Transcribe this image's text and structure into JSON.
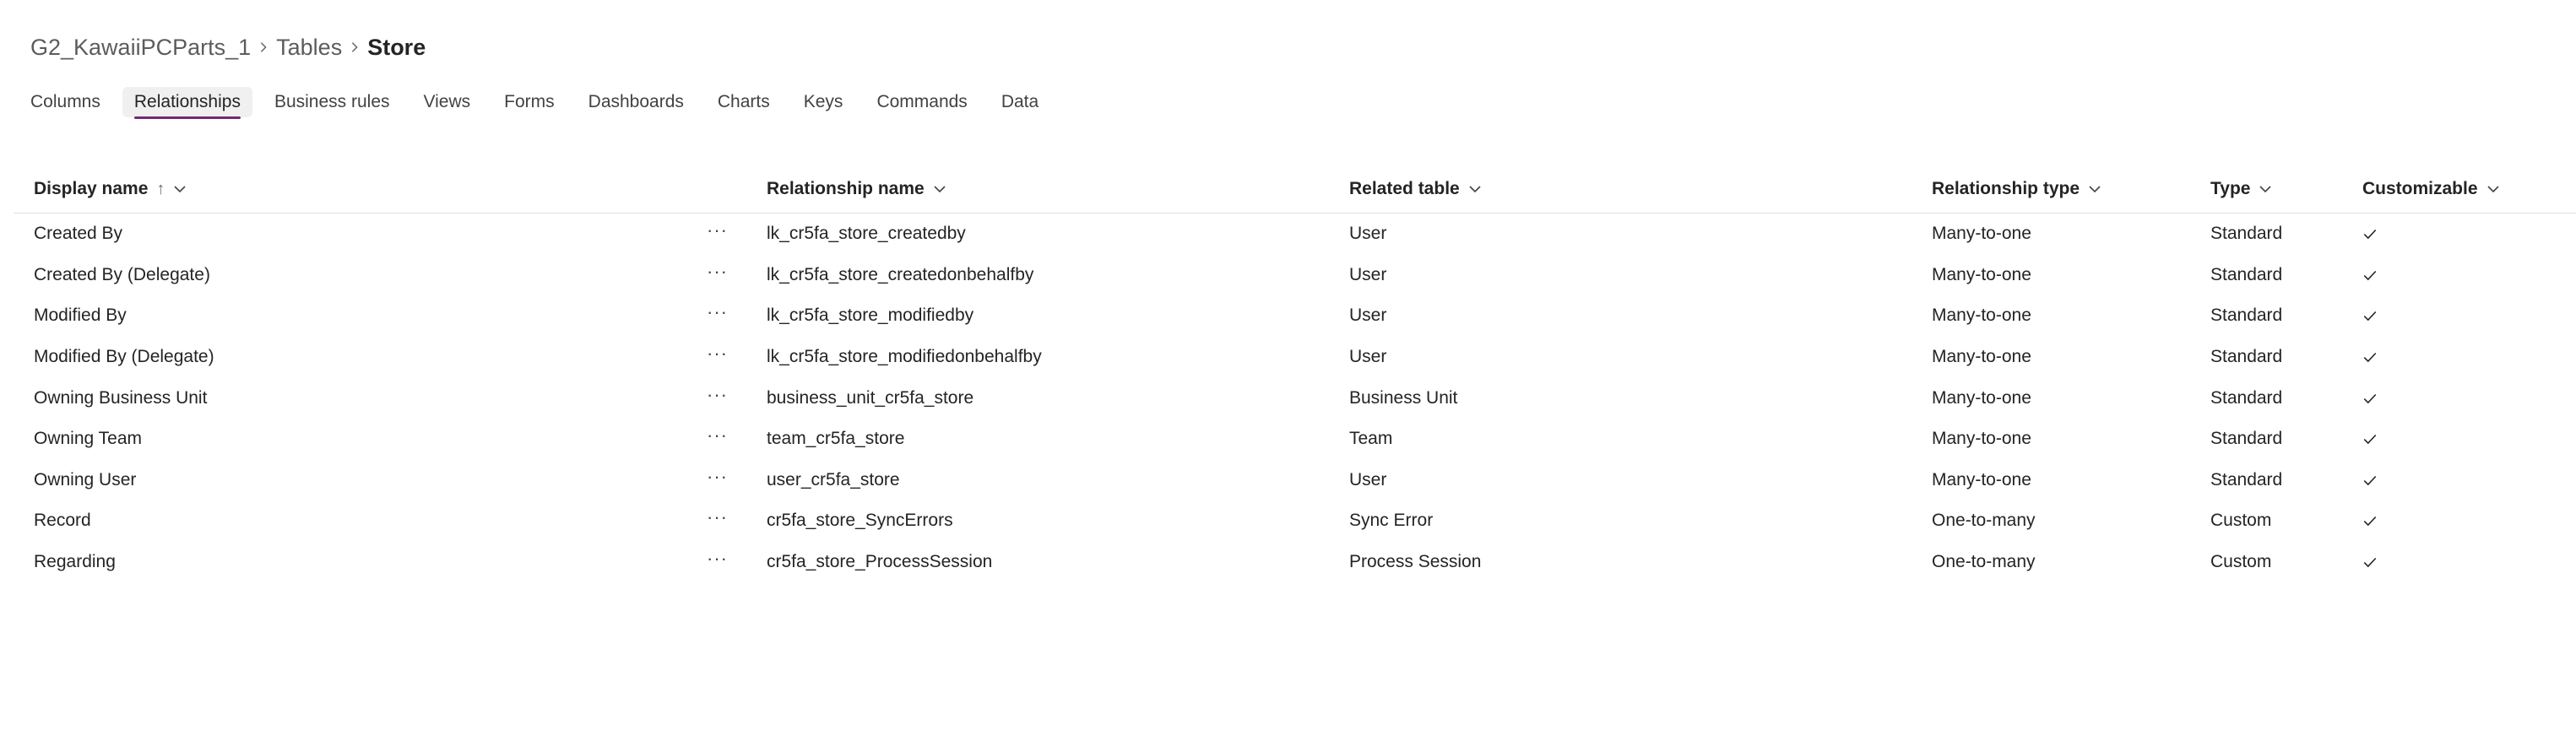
{
  "breadcrumb": {
    "items": [
      "G2_KawaiiPCParts_1",
      "Tables",
      "Store"
    ]
  },
  "tabs": [
    {
      "label": "Columns",
      "active": false
    },
    {
      "label": "Relationships",
      "active": true
    },
    {
      "label": "Business rules",
      "active": false
    },
    {
      "label": "Views",
      "active": false
    },
    {
      "label": "Forms",
      "active": false
    },
    {
      "label": "Dashboards",
      "active": false
    },
    {
      "label": "Charts",
      "active": false
    },
    {
      "label": "Keys",
      "active": false
    },
    {
      "label": "Commands",
      "active": false
    },
    {
      "label": "Data",
      "active": false
    }
  ],
  "table": {
    "headers": {
      "display_name": "Display name",
      "relationship_name": "Relationship name",
      "related_table": "Related table",
      "relationship_type": "Relationship type",
      "type": "Type",
      "customizable": "Customizable"
    },
    "sort_indicator": "↑",
    "more_label": "···",
    "rows": [
      {
        "display_name": "Created By",
        "relationship_name": "lk_cr5fa_store_createdby",
        "related_table": "User",
        "relationship_type": "Many-to-one",
        "type": "Standard",
        "customizable": true
      },
      {
        "display_name": "Created By (Delegate)",
        "relationship_name": "lk_cr5fa_store_createdonbehalfby",
        "related_table": "User",
        "relationship_type": "Many-to-one",
        "type": "Standard",
        "customizable": true
      },
      {
        "display_name": "Modified By",
        "relationship_name": "lk_cr5fa_store_modifiedby",
        "related_table": "User",
        "relationship_type": "Many-to-one",
        "type": "Standard",
        "customizable": true
      },
      {
        "display_name": "Modified By (Delegate)",
        "relationship_name": "lk_cr5fa_store_modifiedonbehalfby",
        "related_table": "User",
        "relationship_type": "Many-to-one",
        "type": "Standard",
        "customizable": true
      },
      {
        "display_name": "Owning Business Unit",
        "relationship_name": "business_unit_cr5fa_store",
        "related_table": "Business Unit",
        "relationship_type": "Many-to-one",
        "type": "Standard",
        "customizable": true
      },
      {
        "display_name": "Owning Team",
        "relationship_name": "team_cr5fa_store",
        "related_table": "Team",
        "relationship_type": "Many-to-one",
        "type": "Standard",
        "customizable": true
      },
      {
        "display_name": "Owning User",
        "relationship_name": "user_cr5fa_store",
        "related_table": "User",
        "relationship_type": "Many-to-one",
        "type": "Standard",
        "customizable": true
      },
      {
        "display_name": "Record",
        "relationship_name": "cr5fa_store_SyncErrors",
        "related_table": "Sync Error",
        "relationship_type": "One-to-many",
        "type": "Custom",
        "customizable": true
      },
      {
        "display_name": "Regarding",
        "relationship_name": "cr5fa_store_ProcessSession",
        "related_table": "Process Session",
        "relationship_type": "One-to-many",
        "type": "Custom",
        "customizable": true
      }
    ]
  },
  "colors": {
    "accent": "#742774",
    "text": "#242424",
    "muted": "#616161"
  }
}
